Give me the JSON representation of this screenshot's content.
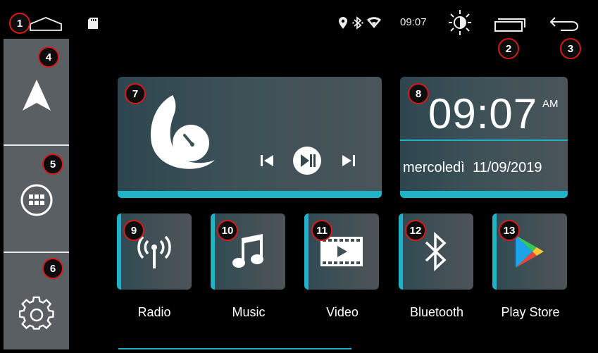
{
  "status_bar": {
    "time": "09:07",
    "icons": [
      "home-outline-icon",
      "sd-card-icon",
      "location-pin-icon",
      "bluetooth-icon",
      "wifi-icon",
      "brightness-icon",
      "recent-apps-icon",
      "back-arrow-icon"
    ]
  },
  "sidebar": {
    "items": [
      {
        "icon": "navigation-arrow-icon"
      },
      {
        "icon": "app-grid-icon"
      },
      {
        "icon": "settings-gear-icon"
      }
    ]
  },
  "media_widget": {
    "controls": [
      "previous-track-icon",
      "play-pause-icon",
      "next-track-icon"
    ]
  },
  "clock_widget": {
    "time": "09:07",
    "ampm": "AM",
    "day": "mercoledì",
    "date": "11/09/2019"
  },
  "apps": [
    {
      "label": "Radio",
      "icon": "radio-antenna-icon"
    },
    {
      "label": "Music",
      "icon": "music-note-icon"
    },
    {
      "label": "Video",
      "icon": "video-film-icon"
    },
    {
      "label": "Bluetooth",
      "icon": "bluetooth-icon"
    },
    {
      "label": "Play Store",
      "icon": "play-store-icon"
    }
  ],
  "callouts": [
    "1",
    "2",
    "3",
    "4",
    "5",
    "6",
    "7",
    "8",
    "9",
    "10",
    "11",
    "12",
    "13"
  ],
  "colors": {
    "accent": "#1fb3c7",
    "sidebar": "#5a5f63",
    "callout_border": "#d71a1a"
  }
}
